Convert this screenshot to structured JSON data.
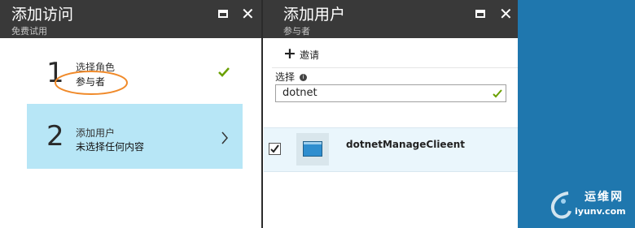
{
  "left_blade": {
    "title": "添加访问",
    "subtitle": "免费试用",
    "steps": [
      {
        "number": "1",
        "label": "选择角色",
        "value": "参与者",
        "status": "check-icon"
      },
      {
        "number": "2",
        "label": "添加用户",
        "value": "未选择任何内容",
        "status": "chevron-right-icon"
      }
    ]
  },
  "right_blade": {
    "title": "添加用户",
    "subtitle": "参与者",
    "invite_label": "邀请",
    "select_label": "选择",
    "search_value": "dotnet",
    "results": [
      {
        "name": "dotnetManageClieent",
        "checked": true
      }
    ]
  },
  "watermark": {
    "text_cn": "运维网",
    "text_en": "iyunv.com"
  },
  "colors": {
    "header_bg": "#393939",
    "selected_step_bg": "#b7e6f6",
    "accent_check": "#6aa000",
    "right_panel_bg": "#1f77ae",
    "annotation_ellipse": "#f08a2a"
  }
}
